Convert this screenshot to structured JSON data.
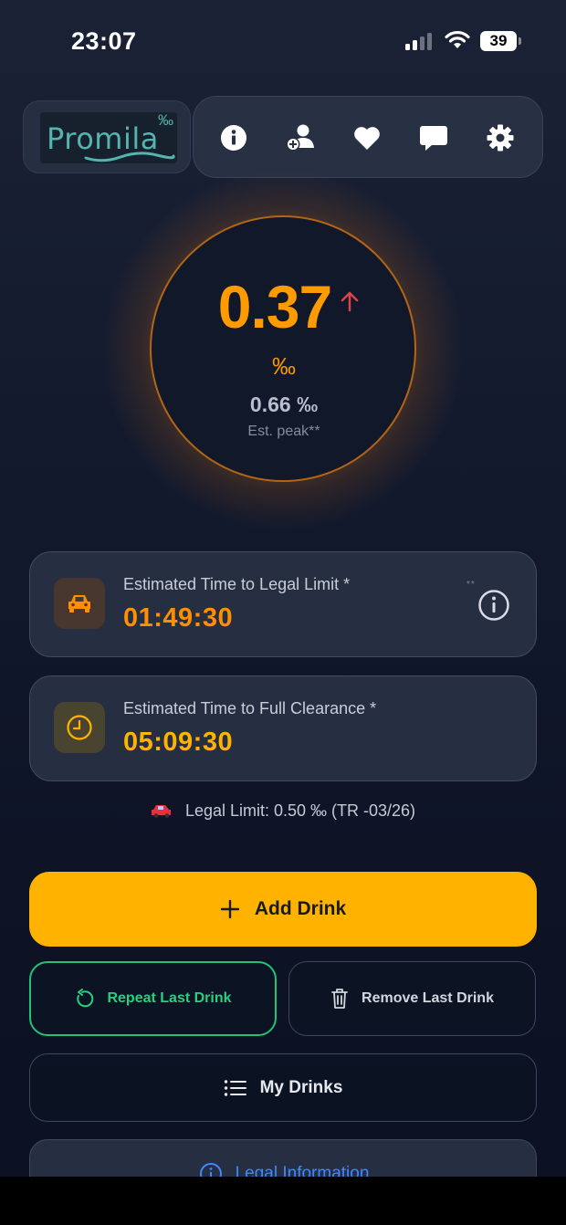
{
  "status_bar": {
    "time": "23:07",
    "battery": "39"
  },
  "header": {
    "logo_text": "Promila",
    "logo_mark": "‰",
    "icons": [
      "info-icon",
      "add-person-icon",
      "heart-icon",
      "chat-icon",
      "gear-icon"
    ]
  },
  "gauge": {
    "current_value": "0.37",
    "trend": "rising",
    "unit": "‰",
    "peak_value": "0.66 ‰",
    "peak_label": "Est. peak**"
  },
  "cards": {
    "legal": {
      "title": "Estimated Time to Legal Limit *",
      "time": "01:49:30",
      "footnote": "**",
      "icon": "car-icon",
      "color": "#ff8f00"
    },
    "clearance": {
      "title": "Estimated Time to Full Clearance *",
      "time": "05:09:30",
      "icon": "clock-icon",
      "color": "#ffb300"
    }
  },
  "legal_limit_text": "Legal Limit: 0.50 ‰ (TR -03/26)",
  "actions": {
    "add_drink": "Add Drink",
    "repeat_last": "Repeat Last Drink",
    "remove_last": "Remove Last Drink",
    "my_drinks": "My Drinks",
    "legal_info": "Legal Information"
  },
  "colors": {
    "accent": "#ffb300",
    "bac": "#ff9a00",
    "repeat": "#1fc37a",
    "link": "#3f88ff"
  }
}
